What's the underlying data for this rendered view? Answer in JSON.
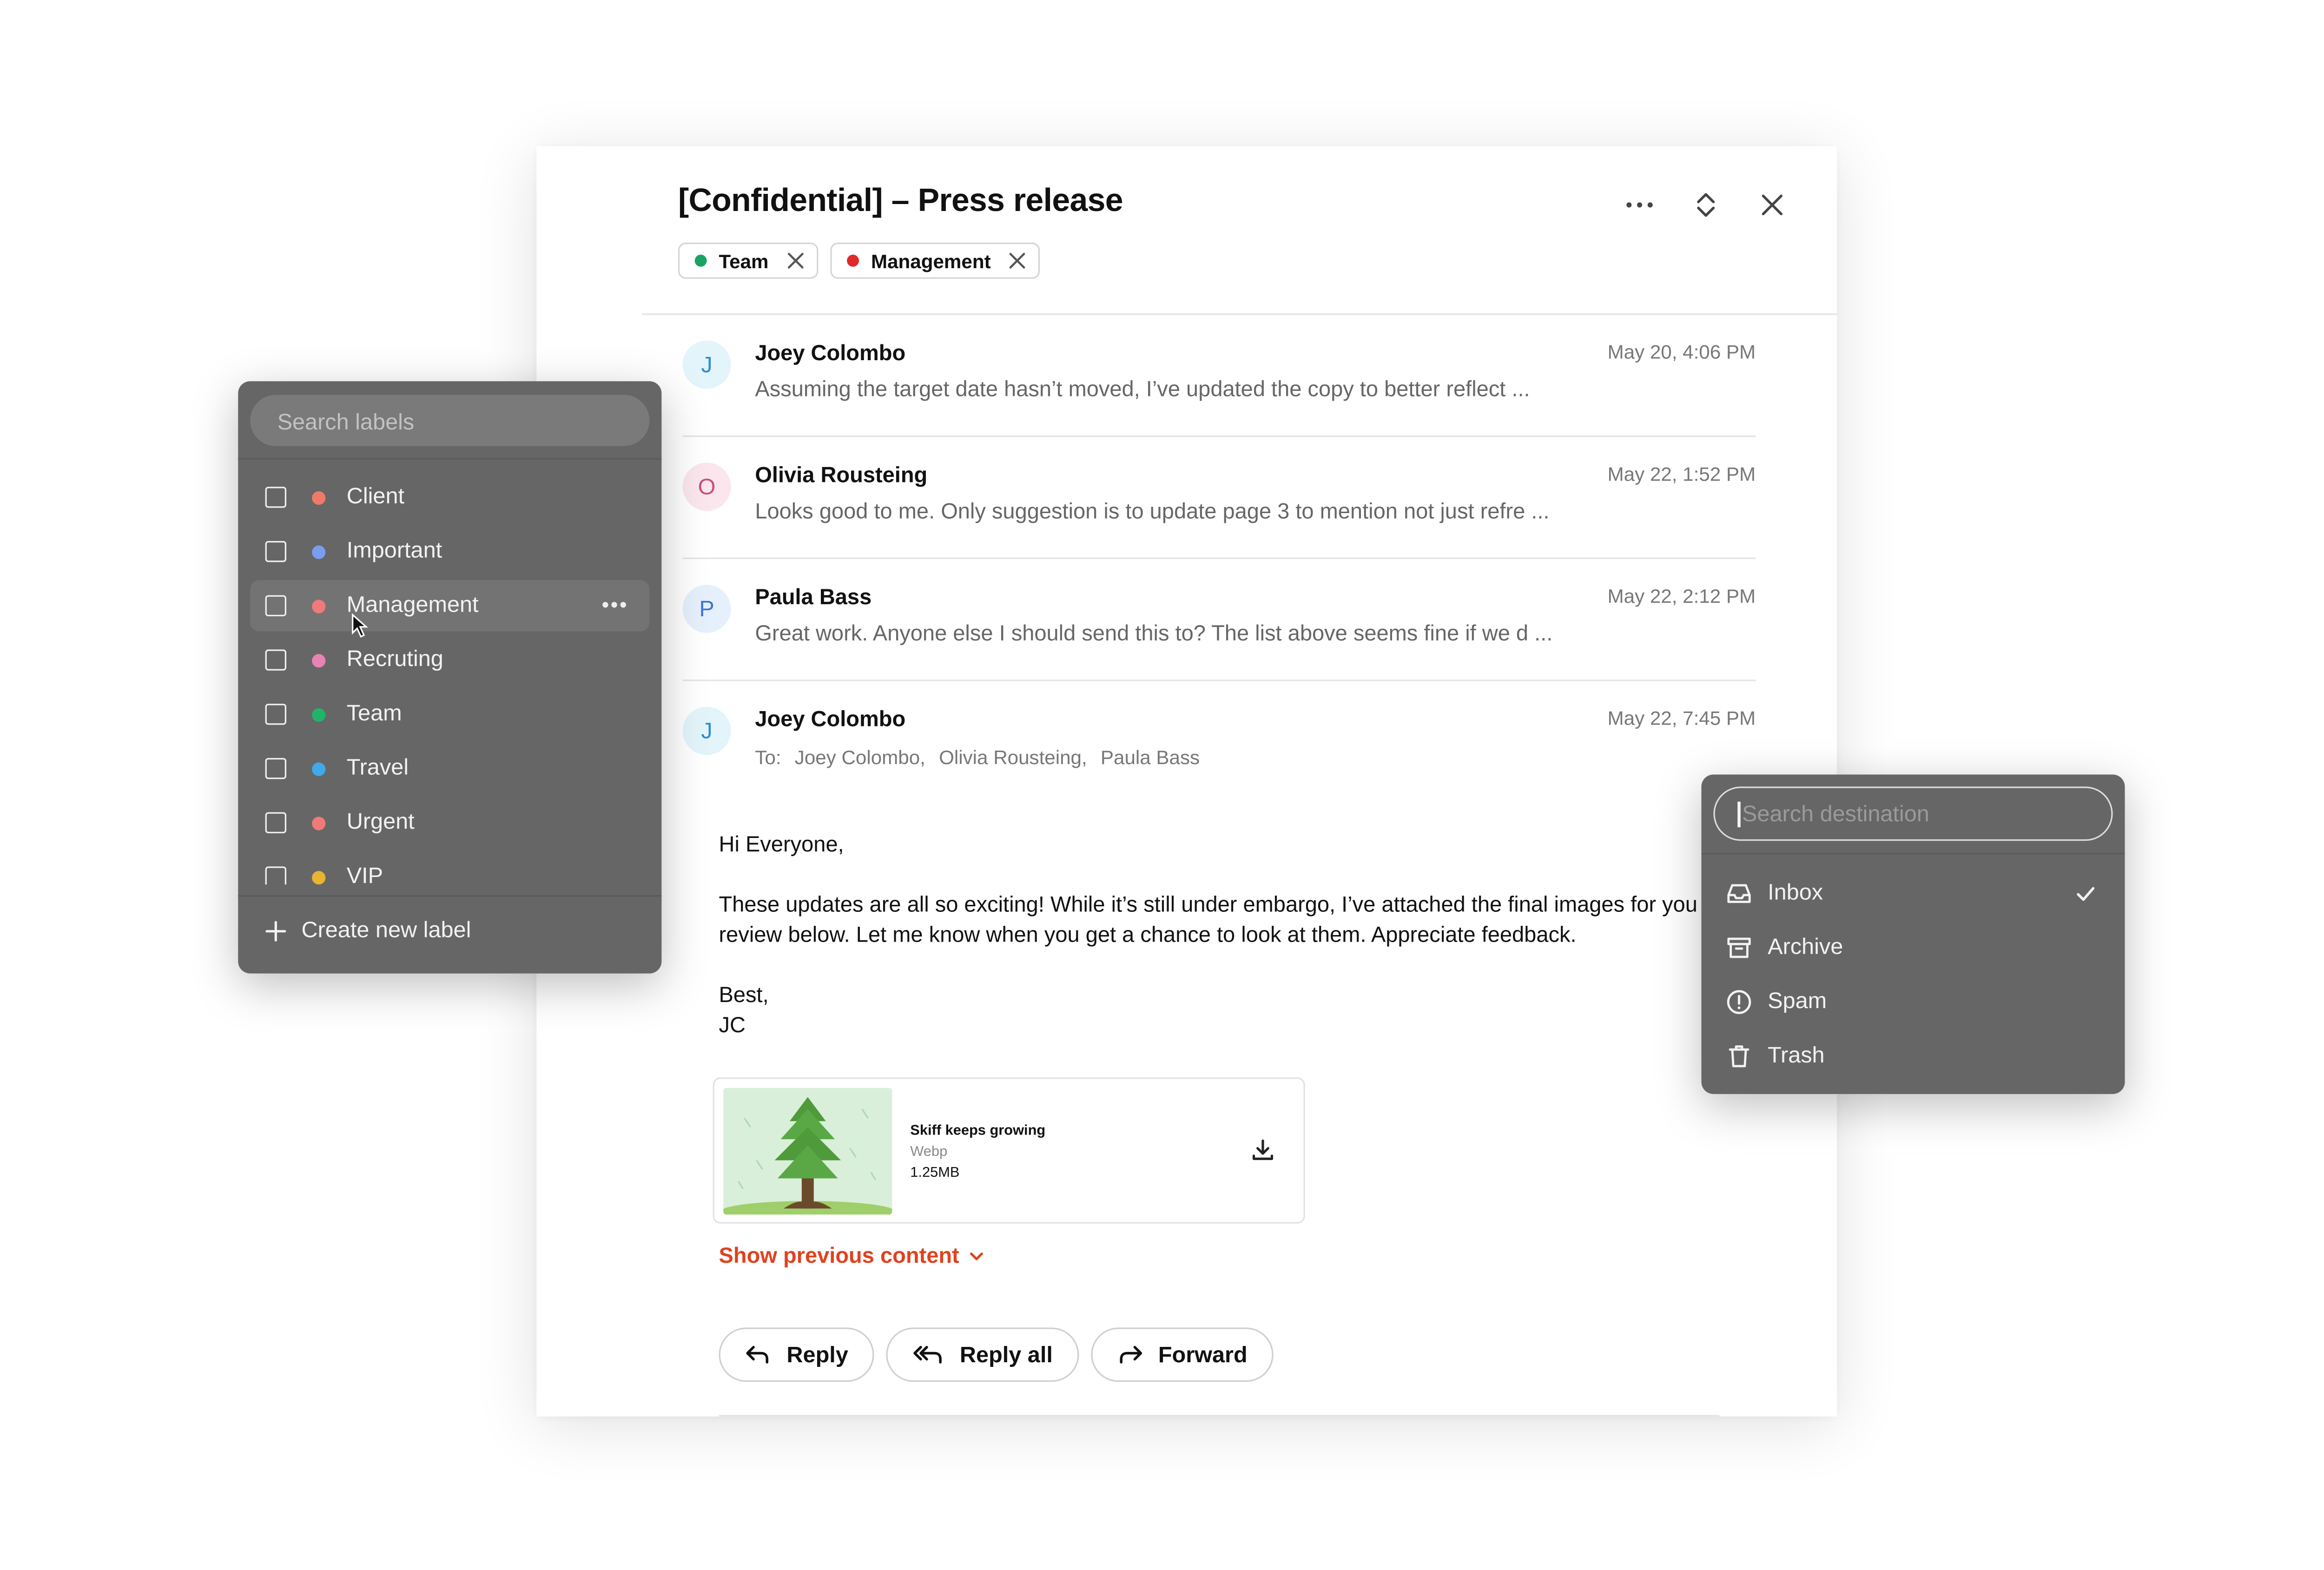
{
  "email": {
    "subject": "[Confidential] – Press release",
    "tags": [
      {
        "label": "Team",
        "color": "#1aa463"
      },
      {
        "label": "Management",
        "color": "#e02a2a"
      }
    ],
    "header_icons": [
      "more-icon",
      "expand-collapse-icon",
      "close-icon"
    ]
  },
  "thread": [
    {
      "initial": "J",
      "sender": "Joey Colombo",
      "date": "May 20, 4:06 PM",
      "preview": "Assuming the target date hasn’t moved, I’ve updated the copy to better reflect  ...",
      "avatar_bg": "#e3f4fb",
      "avatar_fg": "#2a8fd0"
    },
    {
      "initial": "O",
      "sender": "Olivia Rousteing",
      "date": "May 22, 1:52 PM",
      "preview": "Looks good to me. Only suggestion is to update page 3 to mention not just refre ...",
      "avatar_bg": "#fbe6ee",
      "avatar_fg": "#cc4d7a"
    },
    {
      "initial": "P",
      "sender": "Paula Bass",
      "date": "May 22, 2:12 PM",
      "preview": "Great work. Anyone else I should send this to? The list above seems fine if we d  ...",
      "avatar_bg": "#e6f0fd",
      "avatar_fg": "#3b77d6"
    },
    {
      "initial": "J",
      "sender": "Joey Colombo",
      "date": "May 22, 7:45 PM",
      "to_label": "To:",
      "recipients": [
        "Joey Colombo,",
        "Olivia Rousteing,",
        "Paula Bass"
      ],
      "avatar_bg": "#e3f4fb",
      "avatar_fg": "#2a8fd0"
    }
  ],
  "message": {
    "greeting": "Hi Everyone,",
    "paragraph": "These updates are all so exciting! While it’s still under embargo, I’ve attached the final images for you to review below. Let me know when you get a chance to look at them. Appreciate feedback.",
    "signoff": "Best,",
    "signature": "JC"
  },
  "attachment": {
    "name": "Skiff keeps growing",
    "type": "Webp",
    "size": "1.25MB"
  },
  "show_previous": "Show previous content",
  "actions": {
    "reply": "Reply",
    "reply_all": "Reply all",
    "forward": "Forward"
  },
  "labels_menu": {
    "search_placeholder": "Search labels",
    "items": [
      {
        "label": "Client",
        "color": "#f07a6a"
      },
      {
        "label": "Important",
        "color": "#7c9cf0"
      },
      {
        "label": "Management",
        "color": "#f07a7a"
      },
      {
        "label": "Recruting",
        "color": "#e883b4"
      },
      {
        "label": "Team",
        "color": "#22b36b"
      },
      {
        "label": "Travel",
        "color": "#41a8ea"
      },
      {
        "label": "Urgent",
        "color": "#f07a7a"
      },
      {
        "label": "VIP",
        "color": "#e8b530"
      }
    ],
    "more": "•••",
    "create": "Create new label"
  },
  "destination_menu": {
    "search_placeholder": "Search destination",
    "items": [
      {
        "label": "Inbox",
        "icon": "inbox-icon",
        "selected": true
      },
      {
        "label": "Archive",
        "icon": "archive-icon"
      },
      {
        "label": "Spam",
        "icon": "spam-icon"
      },
      {
        "label": "Trash",
        "icon": "trash-icon"
      }
    ]
  },
  "colors": {
    "accent_red": "#e0421e",
    "menu_bg": "#666666"
  }
}
